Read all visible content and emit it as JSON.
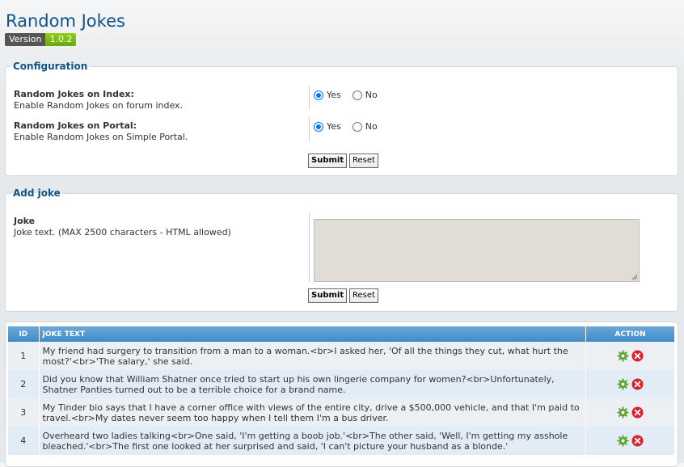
{
  "page": {
    "title": "Random Jokes",
    "version_label": "Version",
    "version_value": "1.0.2"
  },
  "config": {
    "legend": "Configuration",
    "rows": [
      {
        "title": "Random Jokes on Index:",
        "desc": "Enable Random Jokes on forum index.",
        "yes": "Yes",
        "no": "No",
        "selected": "yes"
      },
      {
        "title": "Random Jokes on Portal:",
        "desc": "Enable Random Jokes on Simple Portal.",
        "yes": "Yes",
        "no": "No",
        "selected": "yes"
      }
    ],
    "submit": "Submit",
    "reset": "Reset"
  },
  "add": {
    "legend": "Add joke",
    "title": "Joke",
    "desc": "Joke text. (MAX 2500 characters - HTML allowed)",
    "textarea_value": "",
    "submit": "Submit",
    "reset": "Reset"
  },
  "table": {
    "headers": {
      "id": "ID",
      "text": "JOKE TEXT",
      "action": "ACTION"
    },
    "rows": [
      {
        "id": "1",
        "text": "My friend had surgery to transition from a man to a woman.<br>I asked her, 'Of all the things they cut, what hurt the most?'<br>'The salary,' she said."
      },
      {
        "id": "2",
        "text": "Did you know that William Shatner once tried to start up his own lingerie company for women?<br>Unfortunately, Shatner Panties turned out to be a terrible choice for a brand name."
      },
      {
        "id": "3",
        "text": "My Tinder bio says that I have a corner office with views of the entire city, drive a $500,000 vehicle, and that I'm paid to travel.<br>My dates never seem too happy when I tell them I'm a bus driver."
      },
      {
        "id": "4",
        "text": "Overheard two ladies talking<br>One said, 'I'm getting a boob job.'<br>The other said, 'Well, I'm getting my asshole bleached.'<br>The first one looked at her surprised and said, 'I can't picture your husband as a blonde.'"
      }
    ],
    "colors": {
      "edit_icon": "#5aa02c",
      "delete_icon": "#d9232d",
      "header": "#4a93cf"
    }
  }
}
